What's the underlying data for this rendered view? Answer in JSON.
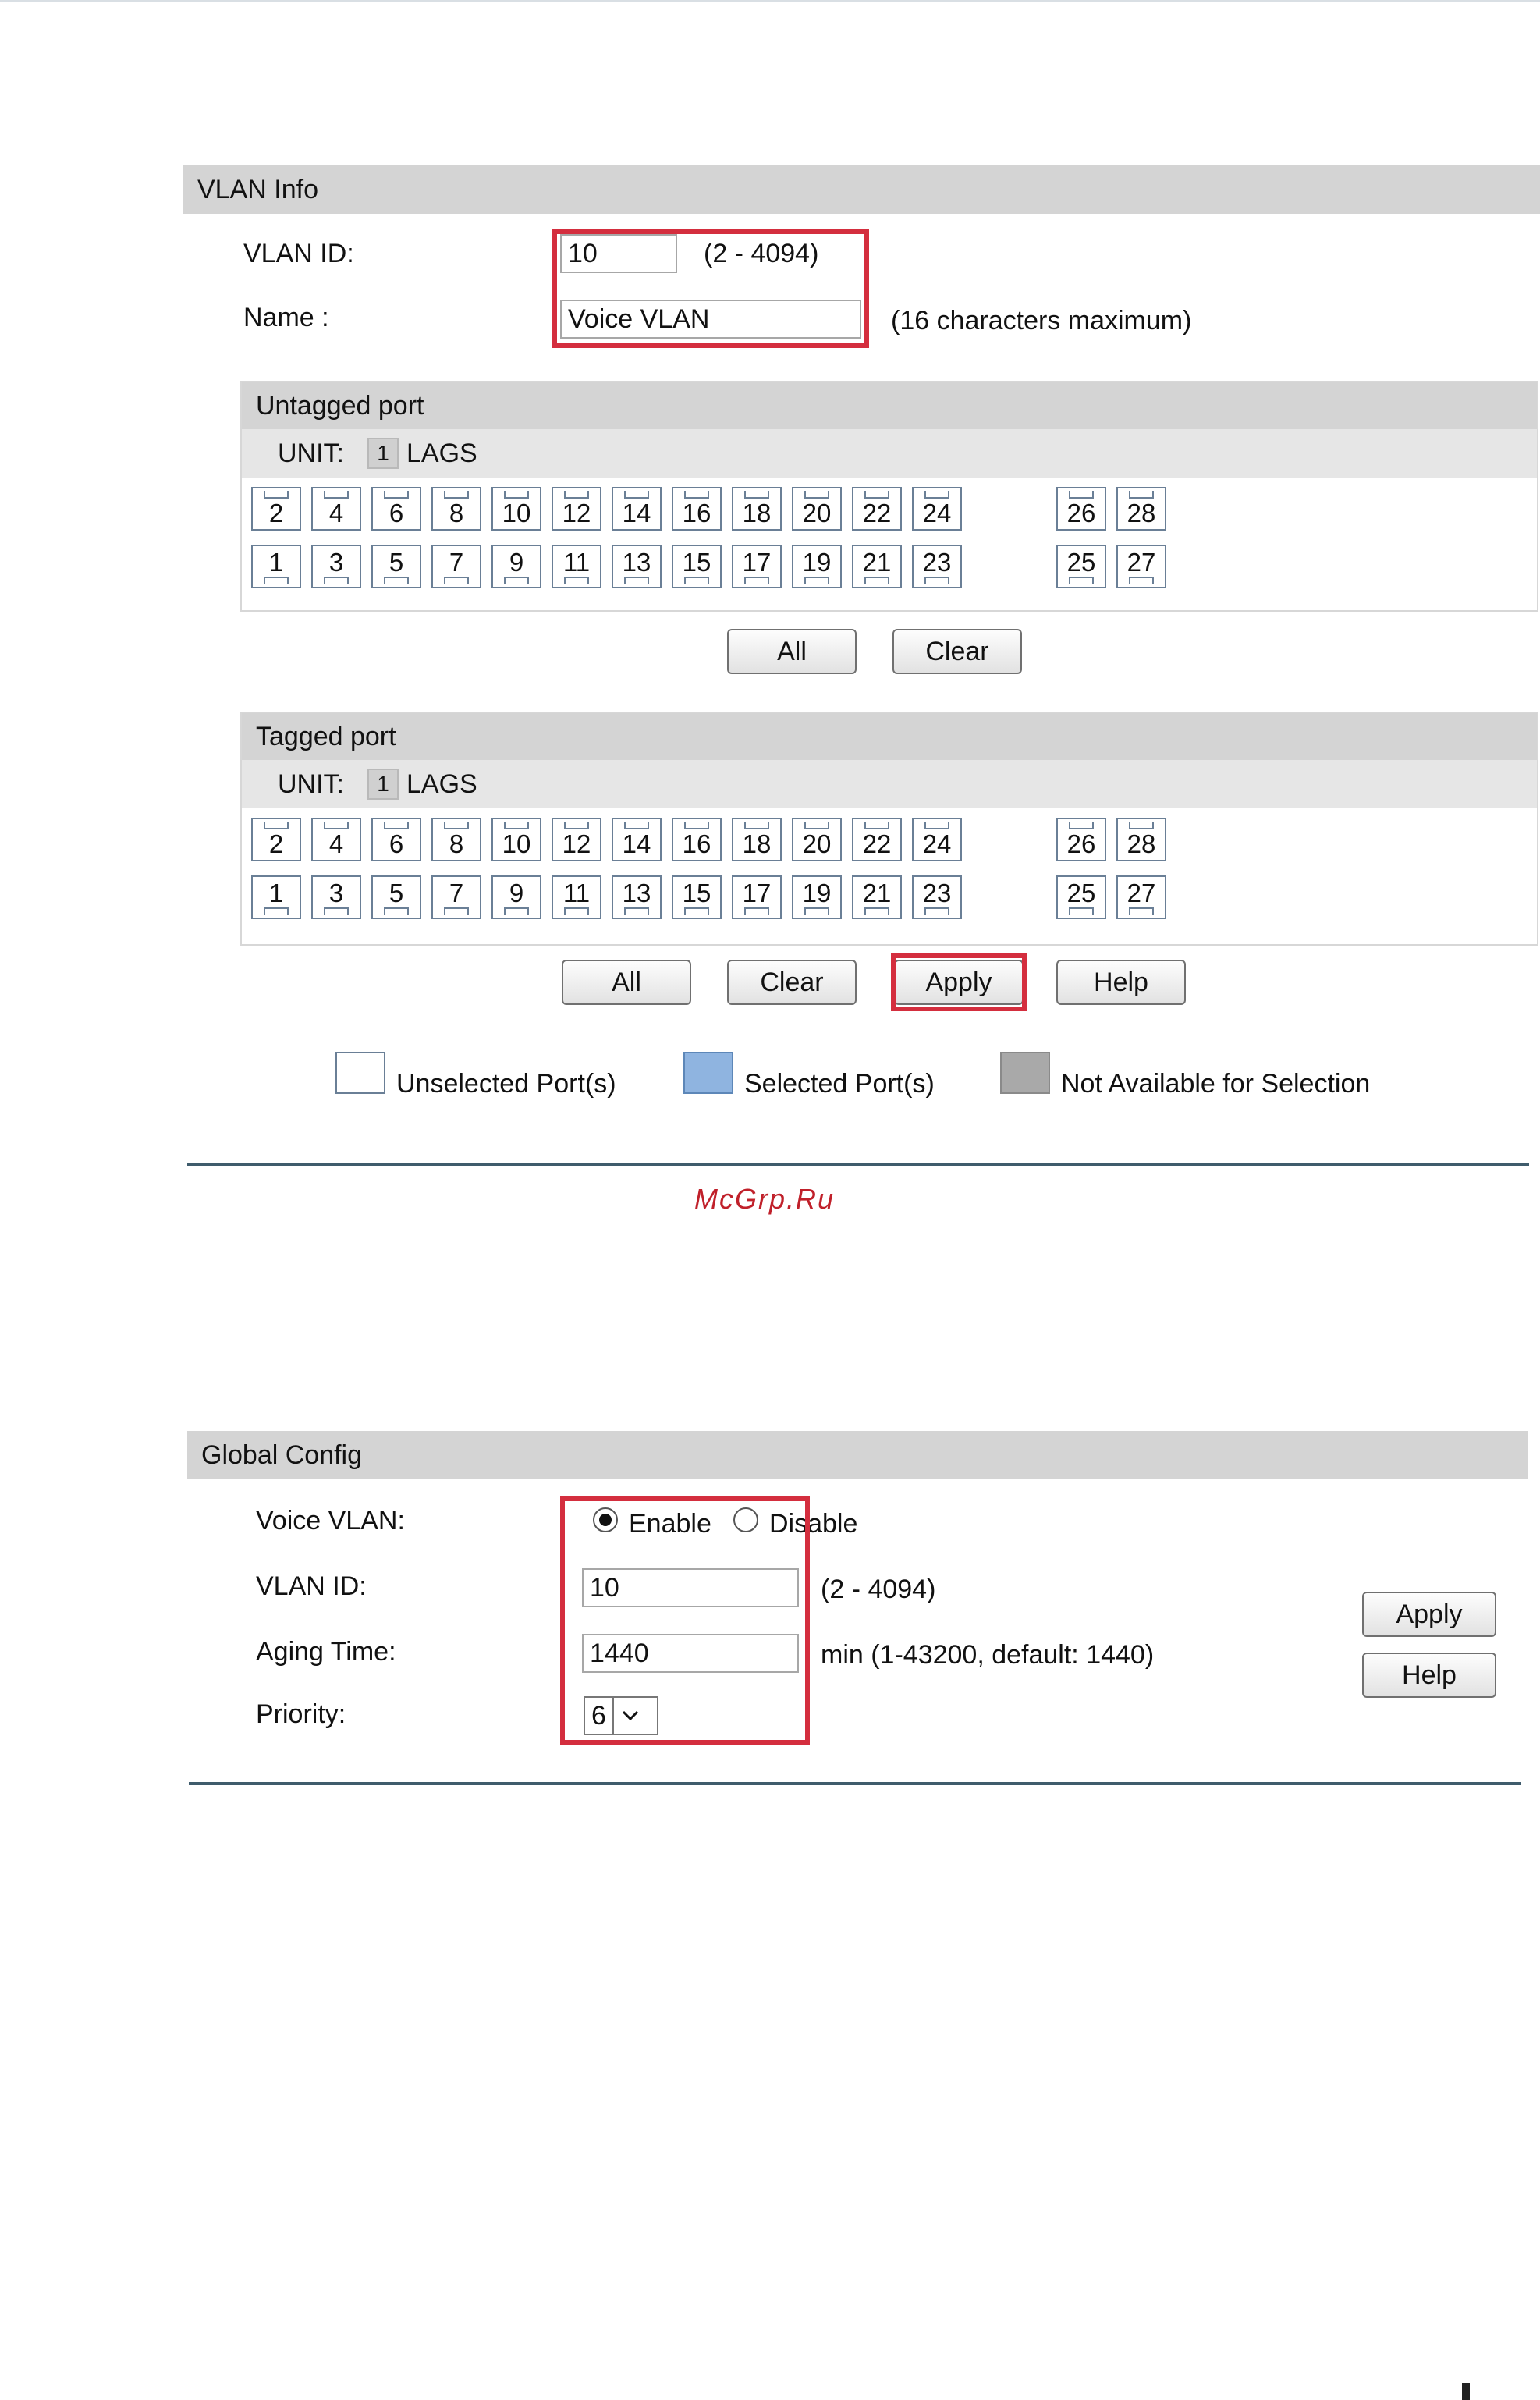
{
  "watermark": "McGrp.Ru",
  "vlan_info": {
    "title": "VLAN Info",
    "vlan_id_label": "VLAN ID:",
    "vlan_id_value": "10",
    "vlan_id_hint": "(2 - 4094)",
    "name_label": "Name :",
    "name_value": "Voice VLAN",
    "name_hint": "(16 characters maximum)",
    "untagged": {
      "title": "Untagged port",
      "unit_label": "UNIT:",
      "unit_value": "1",
      "lags_label": "LAGS",
      "top_ports": [
        "2",
        "4",
        "6",
        "8",
        "10",
        "12",
        "14",
        "16",
        "18",
        "20",
        "22",
        "24",
        "26",
        "28"
      ],
      "bottom_ports": [
        "1",
        "3",
        "5",
        "7",
        "9",
        "11",
        "13",
        "15",
        "17",
        "19",
        "21",
        "23",
        "25",
        "27"
      ],
      "all_label": "All",
      "clear_label": "Clear"
    },
    "tagged": {
      "title": "Tagged port",
      "unit_label": "UNIT:",
      "unit_value": "1",
      "lags_label": "LAGS",
      "top_ports": [
        "2",
        "4",
        "6",
        "8",
        "10",
        "12",
        "14",
        "16",
        "18",
        "20",
        "22",
        "24",
        "26",
        "28"
      ],
      "bottom_ports": [
        "1",
        "3",
        "5",
        "7",
        "9",
        "11",
        "13",
        "15",
        "17",
        "19",
        "21",
        "23",
        "25",
        "27"
      ],
      "all_label": "All",
      "clear_label": "Clear",
      "apply_label": "Apply",
      "help_label": "Help"
    },
    "legend": {
      "unselected": "Unselected Port(s)",
      "selected": "Selected Port(s)",
      "not_available": "Not Available for Selection"
    }
  },
  "global_config": {
    "title": "Global Config",
    "voice_vlan_label": "Voice VLAN:",
    "enable_label": "Enable",
    "disable_label": "Disable",
    "enabled": true,
    "vlan_id_label": "VLAN ID:",
    "vlan_id_value": "10",
    "vlan_id_hint": "(2 - 4094)",
    "aging_label": "Aging Time:",
    "aging_value": "1440",
    "aging_hint": "min (1-43200, default: 1440)",
    "priority_label": "Priority:",
    "priority_value": "6",
    "apply_label": "Apply",
    "help_label": "Help"
  },
  "colors": {
    "highlight": "#d42e3e",
    "section_bar": "#d4d4d4",
    "rule": "#3f5c6c",
    "watermark": "#c0202a"
  }
}
